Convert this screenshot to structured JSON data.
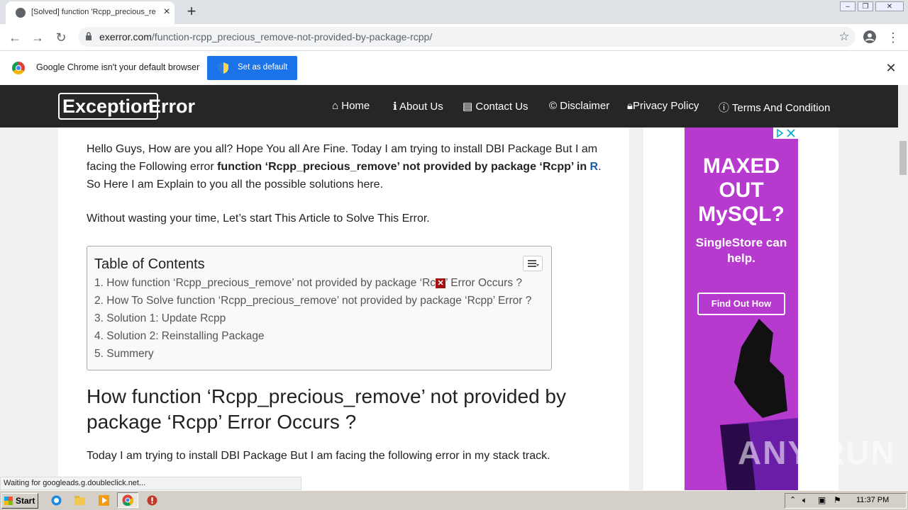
{
  "browser": {
    "tab_title": "[Solved] function 'Rcpp_precious_re",
    "url_domain": "exerror.com",
    "url_path": "/function-rcpp_precious_remove-not-provided-by-package-rcpp/",
    "infobar_text": "Google Chrome isn't your default browser",
    "infobar_button": "Set as default",
    "status": "Waiting for googleads.g.doubleclick.net..."
  },
  "site": {
    "logo_boxed": "Exception",
    "logo_rest": "Error",
    "nav": [
      {
        "icon": "home-icon",
        "label": "Home"
      },
      {
        "icon": "info-icon",
        "label": "About Us"
      },
      {
        "icon": "contact-card-icon",
        "label": "Contact Us"
      },
      {
        "icon": "copyright-icon",
        "label": "Disclaimer"
      },
      {
        "icon": "lock-icon",
        "label": "Privacy Policy"
      },
      {
        "icon": "info-circle-icon",
        "label": "Terms And Condition"
      }
    ]
  },
  "article": {
    "intro_part1": "Hello Guys, How are you all? Hope You all Are Fine. Today I am trying to install DBI Package But I am facing the Following error ",
    "intro_bold": "function ‘Rcpp_precious_remove’ not provided by package ‘Rcpp’ in ",
    "intro_r": "R",
    "intro_part2": ". So Here I am Explain to you all the possible solutions here.",
    "intro2": "Without wasting your time, Let’s start This Article to Solve This Error.",
    "toc_title": "Table of Contents",
    "toc": [
      {
        "num": "1.",
        "pre": "How function ‘Rcpp_precious_remove’ not provided by package ‘Rc",
        "post": "’ Error Occurs ?"
      },
      {
        "num": "2.",
        "text": "How To Solve function ‘Rcpp_precious_remove’ not provided by package ‘Rcpp’ Error ?"
      },
      {
        "num": "3.",
        "text": "Solution 1: Update Rcpp"
      },
      {
        "num": "4.",
        "text": "Solution 2: Reinstalling Package"
      },
      {
        "num": "5.",
        "text": "Summery"
      }
    ],
    "heading": "How function ‘Rcpp_precious_remove’ not provided by package ‘Rcpp’ Error Occurs ?",
    "para3": "Today I am trying to install DBI Package But I am facing the following error in my stack track."
  },
  "ad": {
    "title": "MAXED OUT MySQL?",
    "subtitle": "SingleStore can help.",
    "button": "Find Out How"
  },
  "watermark": "ANY RUN",
  "taskbar": {
    "start": "Start",
    "clock": "11:37 PM"
  }
}
